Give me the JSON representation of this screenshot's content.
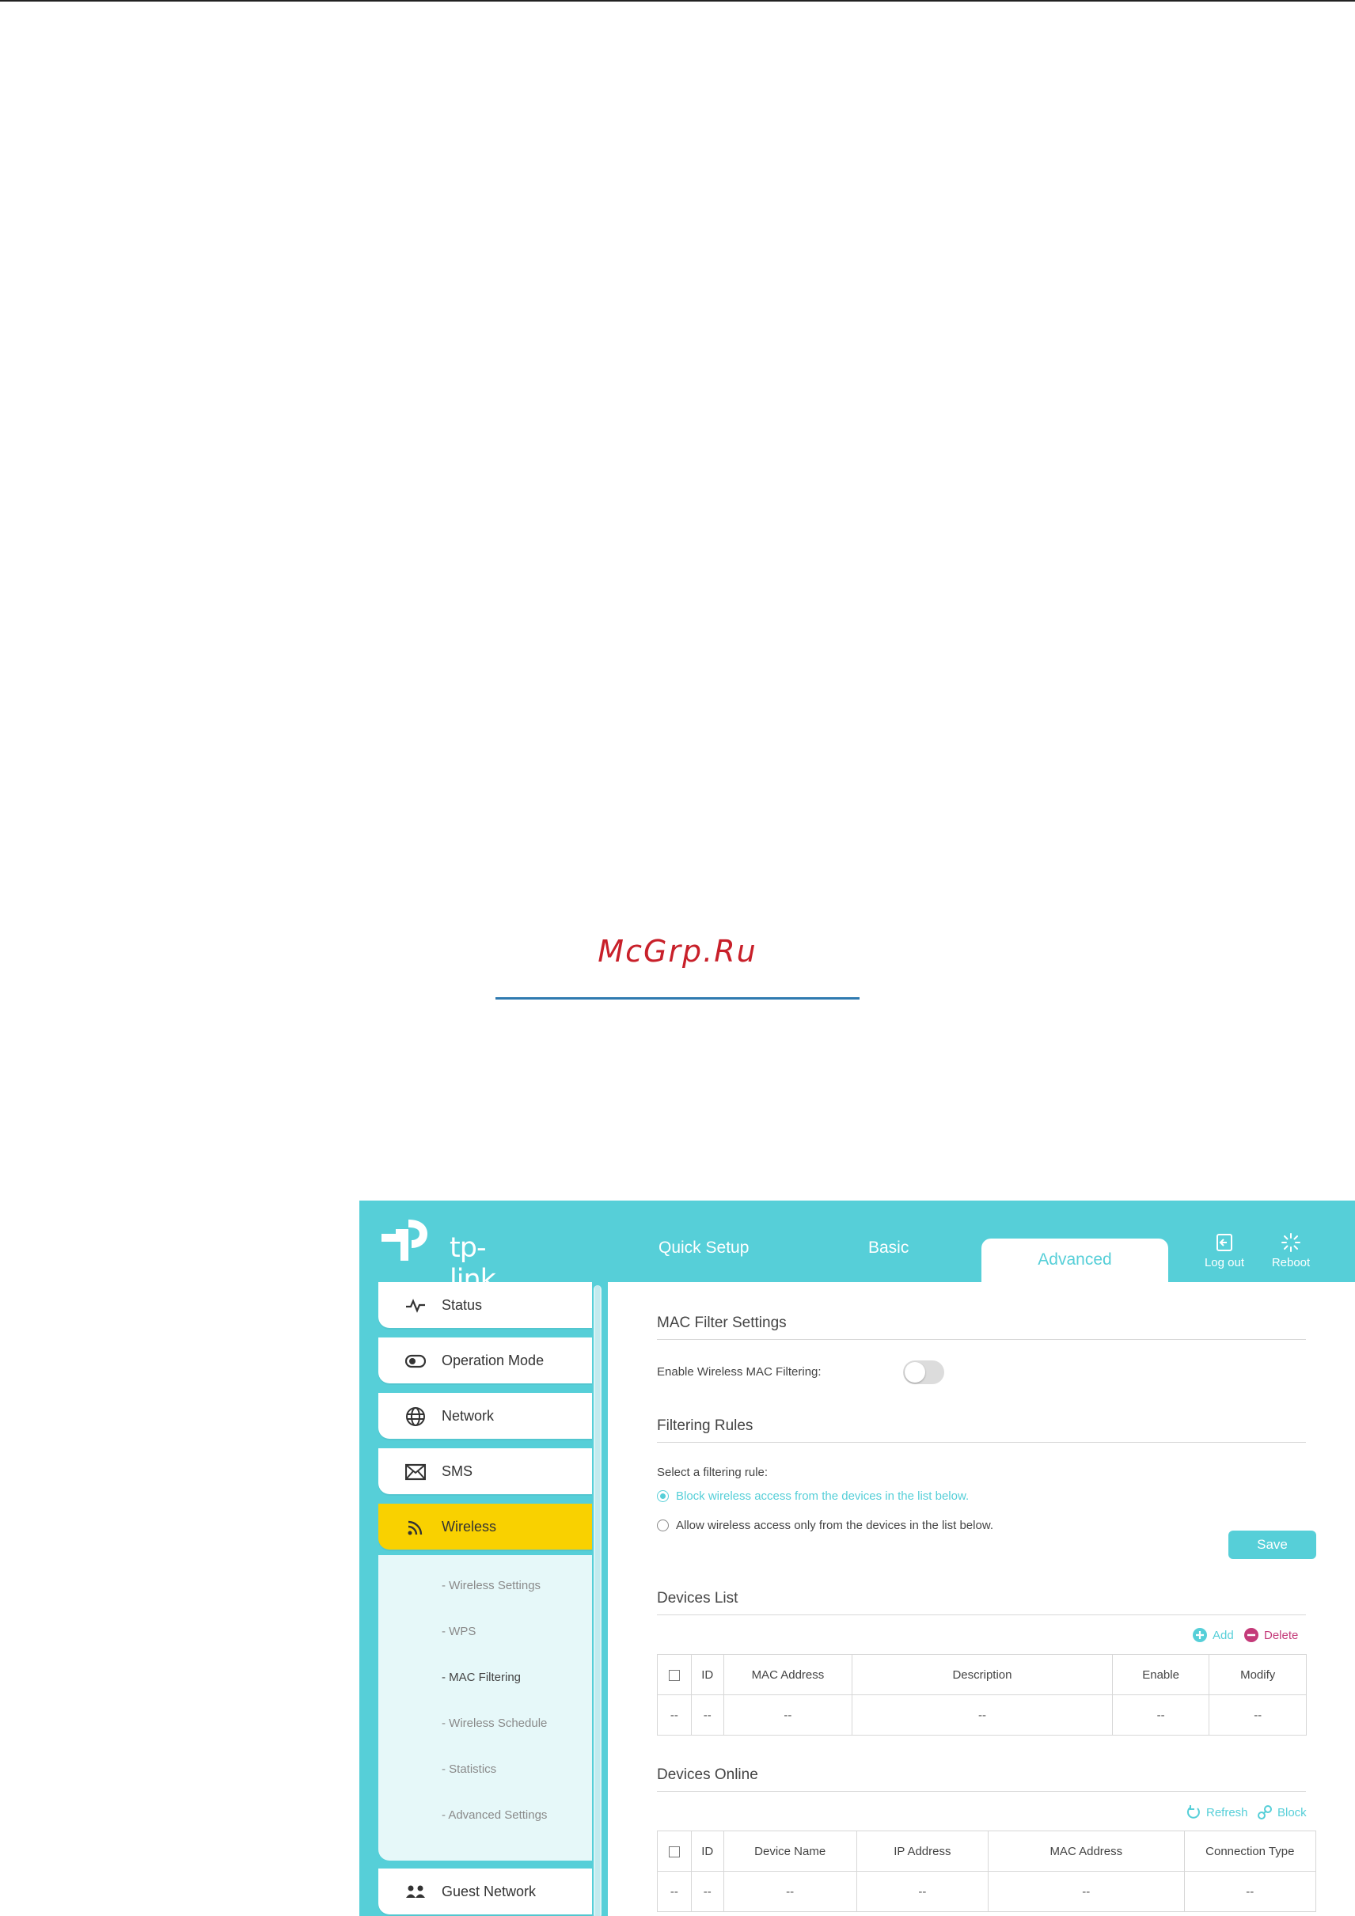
{
  "watermark": {
    "text": "McGrp.Ru"
  },
  "header": {
    "logo_text": "tp-link",
    "tabs": {
      "quick_setup": "Quick Setup",
      "basic": "Basic",
      "advanced": "Advanced"
    },
    "logout_label": "Log out",
    "reboot_label": "Reboot"
  },
  "sidebar": {
    "items": [
      {
        "label": "Status",
        "icon": "status-pulse-icon"
      },
      {
        "label": "Operation Mode",
        "icon": "toggle-icon"
      },
      {
        "label": "Network",
        "icon": "globe-icon"
      },
      {
        "label": "SMS",
        "icon": "envelope-icon"
      },
      {
        "label": "Wireless",
        "icon": "wifi-icon",
        "active": true
      },
      {
        "label": "Guest Network",
        "icon": "guest-users-icon"
      }
    ],
    "submenu": [
      "- Wireless Settings",
      "- WPS",
      "- MAC Filtering",
      "- Wireless Schedule",
      "- Statistics",
      "- Advanced Settings"
    ],
    "active_submenu": "- MAC Filtering"
  },
  "content": {
    "mac_filter_title": "MAC Filter Settings",
    "enable_label": "Enable Wireless MAC Filtering:",
    "enable_state": "off",
    "rules_title": "Filtering Rules",
    "select_rule_label": "Select a filtering rule:",
    "rule_block": "Block wireless access from the devices in the list below.",
    "rule_allow": "Allow wireless access only from the devices in the list below.",
    "selected_rule": "block",
    "save_label": "Save",
    "devices_list": {
      "title": "Devices List",
      "add_label": "Add",
      "delete_label": "Delete",
      "columns": [
        "ID",
        "MAC Address",
        "Description",
        "Enable",
        "Modify"
      ],
      "row": [
        "--",
        "--",
        "--",
        "--",
        "--",
        "--"
      ]
    },
    "devices_online": {
      "title": "Devices Online",
      "refresh_label": "Refresh",
      "block_label": "Block",
      "columns": [
        "ID",
        "Device Name",
        "IP Address",
        "MAC Address",
        "Connection Type"
      ],
      "row": [
        "--",
        "--",
        "--",
        "--",
        "--",
        "--"
      ]
    }
  },
  "colors": {
    "accent": "#56cfd8",
    "active_nav": "#f9d100",
    "delete": "#c43a79",
    "watermark": "#c8202a"
  }
}
